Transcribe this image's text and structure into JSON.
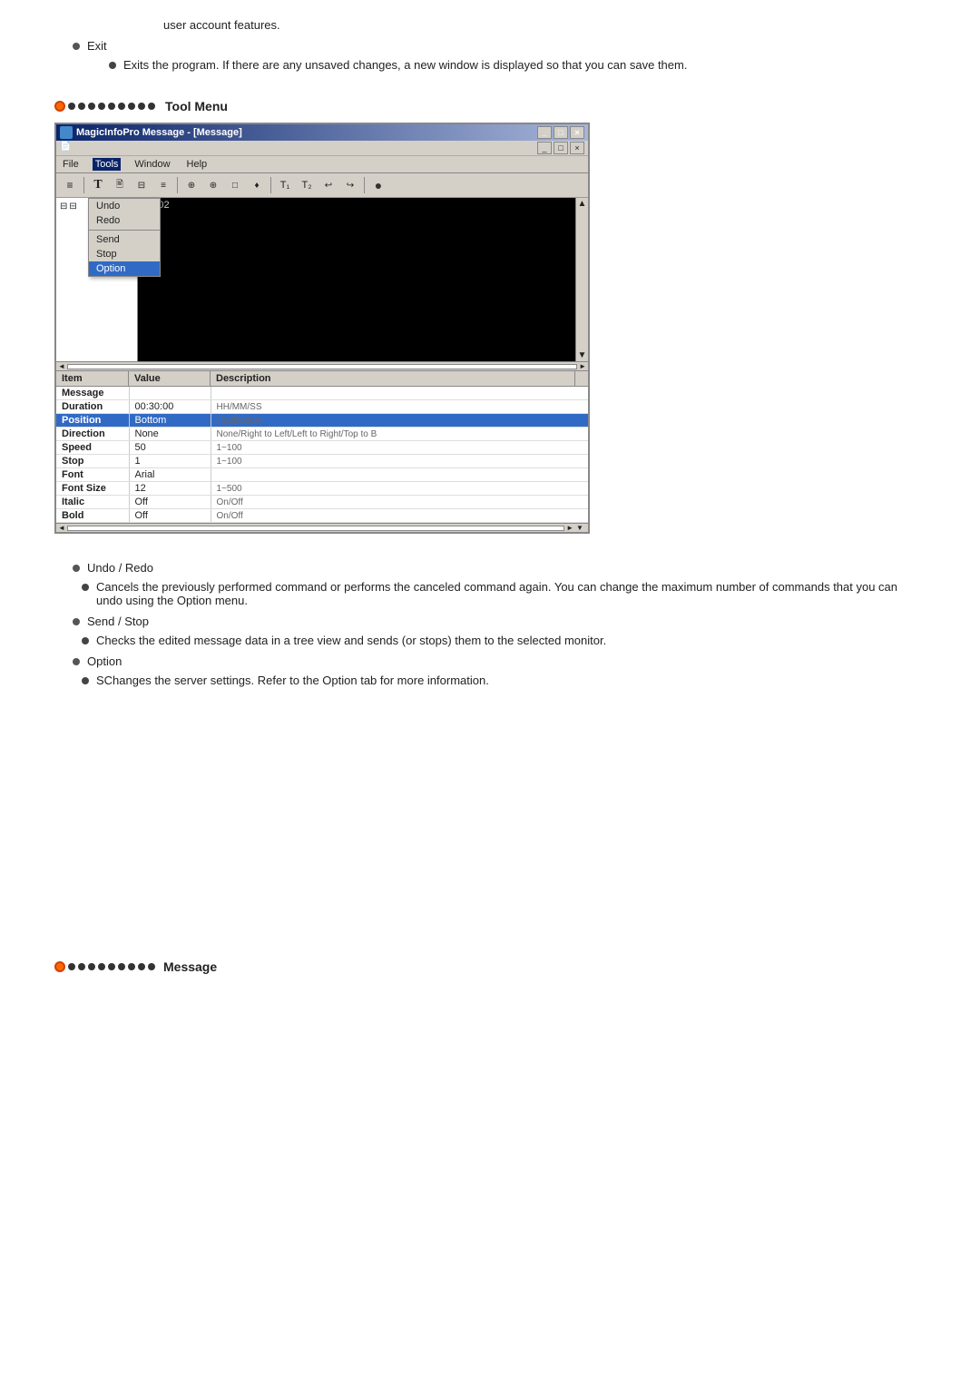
{
  "top": {
    "intro_text": "user account features.",
    "exit_label": "Exit",
    "exit_desc": "Exits the program. If there are any unsaved changes, a new window is displayed so that you can save them."
  },
  "tool_menu_section": {
    "title": "Tool Menu",
    "window_title": "MagicInfoPro Message - [Message]",
    "menu_items": [
      "File",
      "Tools",
      "Window",
      "Help"
    ],
    "toolbar_items": [
      "T",
      "⊟",
      "⊟",
      "≡",
      "⊕",
      "⊕",
      "⊡",
      "♦",
      "T₁",
      "T₂",
      "↩",
      "↪",
      "●"
    ],
    "tree_items": [
      {
        "label": "Undo",
        "expandable": false
      },
      {
        "label": "Redo",
        "expandable": false
      }
    ],
    "dropdown_items": [
      "Undo",
      "Redo",
      "Send",
      "Stop",
      "Option"
    ],
    "content_id": "#0002",
    "props_columns": [
      "Item",
      "Value",
      "Description"
    ],
    "props_rows": [
      {
        "item": "Message",
        "value": "",
        "desc": ""
      },
      {
        "item": "Duration",
        "value": "00:30:00",
        "desc": "HH/MM/SS"
      },
      {
        "item": "Position",
        "value": "Bottom",
        "desc": "Top/Bottom",
        "selected": true
      },
      {
        "item": "Direction",
        "value": "None",
        "desc": "None/Right to Left/Left to Right/Top to B"
      },
      {
        "item": "Speed",
        "value": "50",
        "desc": "1~100"
      },
      {
        "item": "Stop",
        "value": "1",
        "desc": "1~100"
      },
      {
        "item": "Font",
        "value": "Arial",
        "desc": ""
      },
      {
        "item": "Font Size",
        "value": "12",
        "desc": "1~500"
      },
      {
        "item": "Italic",
        "value": "Off",
        "desc": "On/Off"
      },
      {
        "item": "Bold",
        "value": "Off",
        "desc": "On/Off"
      }
    ]
  },
  "descriptions": {
    "undo_redo_title": "Undo / Redo",
    "undo_redo_desc": "Cancels the previously performed command or performs the canceled command again. You can change the maximum number of commands that you can undo using the Option menu.",
    "send_stop_title": "Send / Stop",
    "send_stop_desc": "Checks the edited message data in a tree view and sends (or stops) them to the selected monitor.",
    "option_title": "Option",
    "option_desc": "SChanges the server settings. Refer to the Option tab for more information."
  },
  "bottom_section": {
    "title": "Message"
  }
}
